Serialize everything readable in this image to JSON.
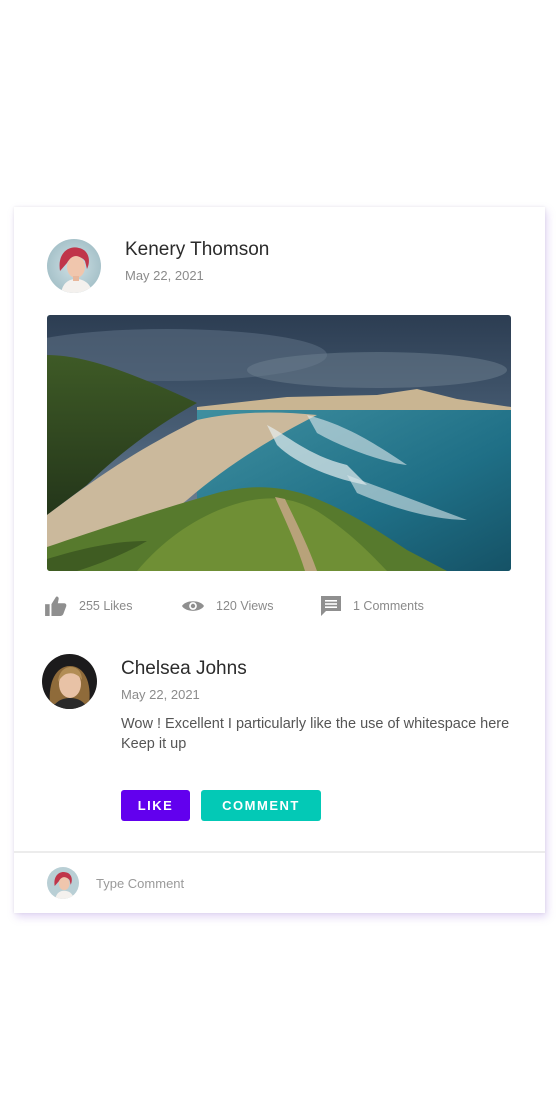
{
  "post": {
    "author_name": "Kenery Thomson",
    "date": "May 22, 2021",
    "image_alt": "coastal-beach-landscape"
  },
  "stats": {
    "likes": "255 Likes",
    "views": "120 Views",
    "comments": "1 Comments"
  },
  "comment": {
    "author_name": "Chelsea Johns",
    "date": "May 22, 2021",
    "text": "Wow ! Excellent I particularly like the use of whitespace here Keep it up"
  },
  "actions": {
    "like_label": "LIKE",
    "comment_label": "COMMENT"
  },
  "reply": {
    "placeholder": "Type Comment"
  },
  "colors": {
    "like_button": "#6200ee",
    "comment_button": "#03c9b6",
    "icon_gray": "#8f8f8f"
  },
  "icons": {
    "likes": "thumbs-up-icon",
    "views": "eye-icon",
    "comments": "comment-icon"
  }
}
